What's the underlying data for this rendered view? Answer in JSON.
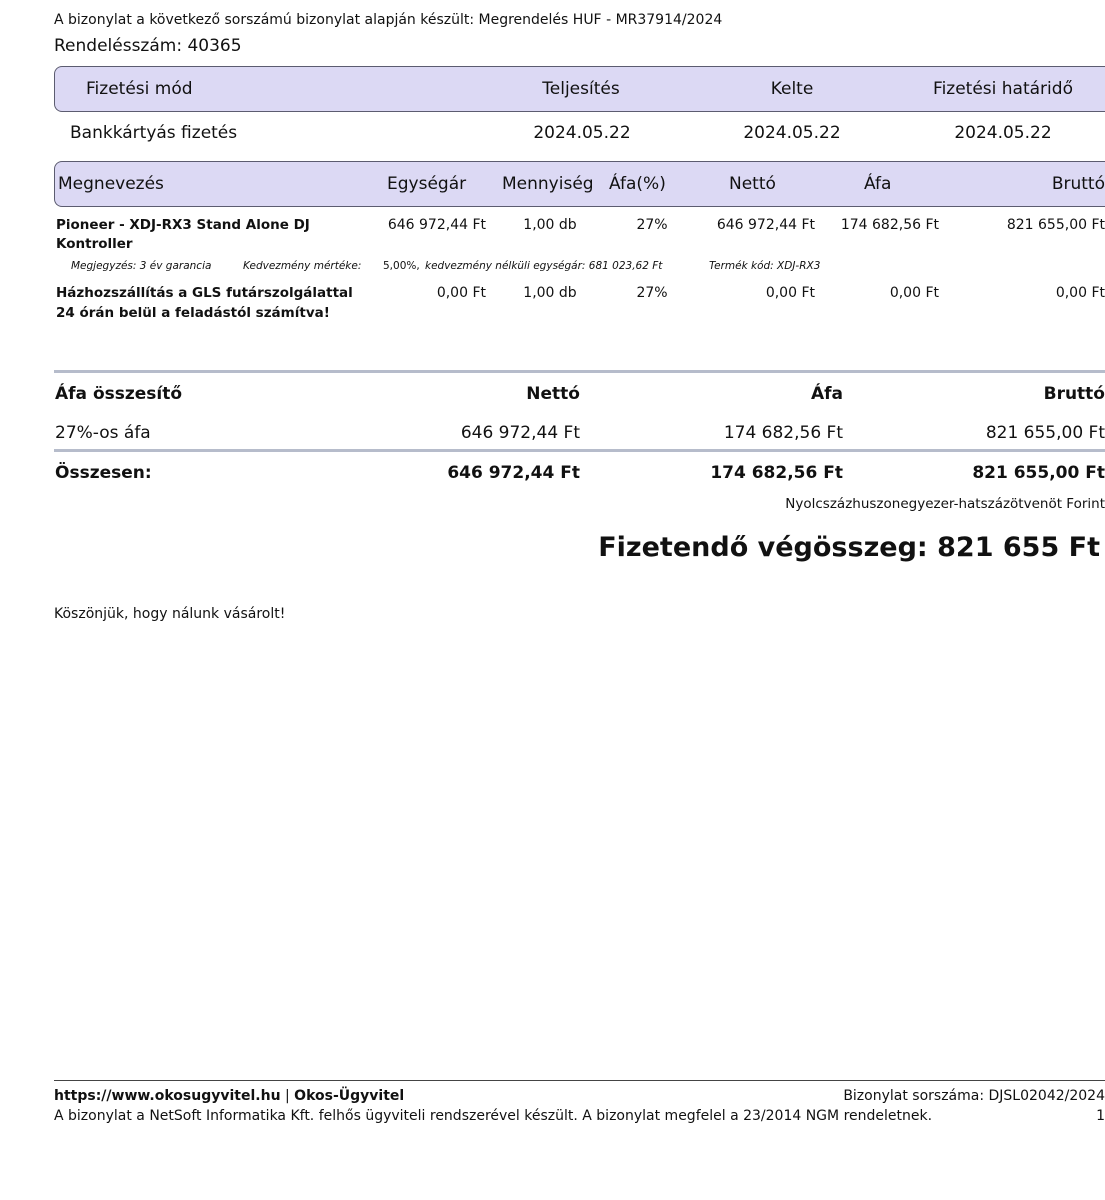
{
  "header": {
    "source_note": "A bizonylat a következő sorszámú bizonylat alapján készült: Megrendelés HUF - MR37914/2024",
    "order_number": "Rendelésszám: 40365"
  },
  "payment": {
    "headers": [
      "Fizetési mód",
      "Teljesítés",
      "Kelte",
      "Fizetési határidő"
    ],
    "values": [
      "Bankkártyás fizetés",
      "2024.05.22",
      "2024.05.22",
      "2024.05.22"
    ]
  },
  "items": {
    "headers": [
      "Megnevezés",
      "Egységár",
      "Mennyiség",
      "Áfa(%)",
      "Nettó",
      "Áfa",
      "Bruttó"
    ],
    "rows": [
      {
        "name_line1": "Pioneer - XDJ-RX3 Stand Alone DJ",
        "name_line2": "Kontroller",
        "unit_price": "646 972,44 Ft",
        "quantity": "1,00 db",
        "vat_pct": "27%",
        "net": "646 972,44 Ft",
        "vat": "174 682,56 Ft",
        "gross": "821 655,00 Ft",
        "note_a": "Megjegyzés: 3 év garancia",
        "note_b": "Kedvezmény mértéke:",
        "note_c": "5,00%,",
        "note_d": "kedvezmény nélküli egységár: 681 023,62 Ft",
        "note_e": "Termék kód: XDJ-RX3"
      },
      {
        "name_line1": "Házhozszállítás a GLS futárszolgálattal",
        "name_line2": "24 órán belül a feladástól számítva!",
        "unit_price": "0,00 Ft",
        "quantity": "1,00 db",
        "vat_pct": "27%",
        "net": "0,00 Ft",
        "vat": "0,00 Ft",
        "gross": "0,00 Ft"
      }
    ]
  },
  "vat_summary": {
    "title": "Áfa összesítő",
    "col_net": "Nettó",
    "col_vat": "Áfa",
    "col_gross": "Bruttó",
    "row_label": "27%-os áfa",
    "row_net": "646 972,44 Ft",
    "row_vat": "174 682,56 Ft",
    "row_gross": "821 655,00 Ft",
    "total_label": "Összesen:",
    "total_net": "646 972,44 Ft",
    "total_vat": "174 682,56 Ft",
    "total_gross": "821 655,00 Ft",
    "in_words": "Nyolcszázhuszonegyezer-hatszázötvenöt Forint"
  },
  "payable": "Fizetendő végösszeg: 821 655 Ft",
  "thanks": "Köszönjük, hogy nálunk vásárolt!",
  "footer": {
    "website": "https://www.okosugyvitel.hu",
    "separator": " | ",
    "brand": "Okos-Ügyvitel",
    "doc_number": "Bizonylat sorszáma: DJSL02042/2024",
    "disclaimer": "A bizonylat a NetSoft Informatika Kft. felhős ügyviteli rendszerével készült. A bizonylat megfelel a 23/2014 NGM rendeletnek.",
    "page": "1"
  },
  "colors": {
    "header_fill": "#dcd9f4",
    "header_border": "#5c5c70",
    "rule": "#b6bccb"
  }
}
